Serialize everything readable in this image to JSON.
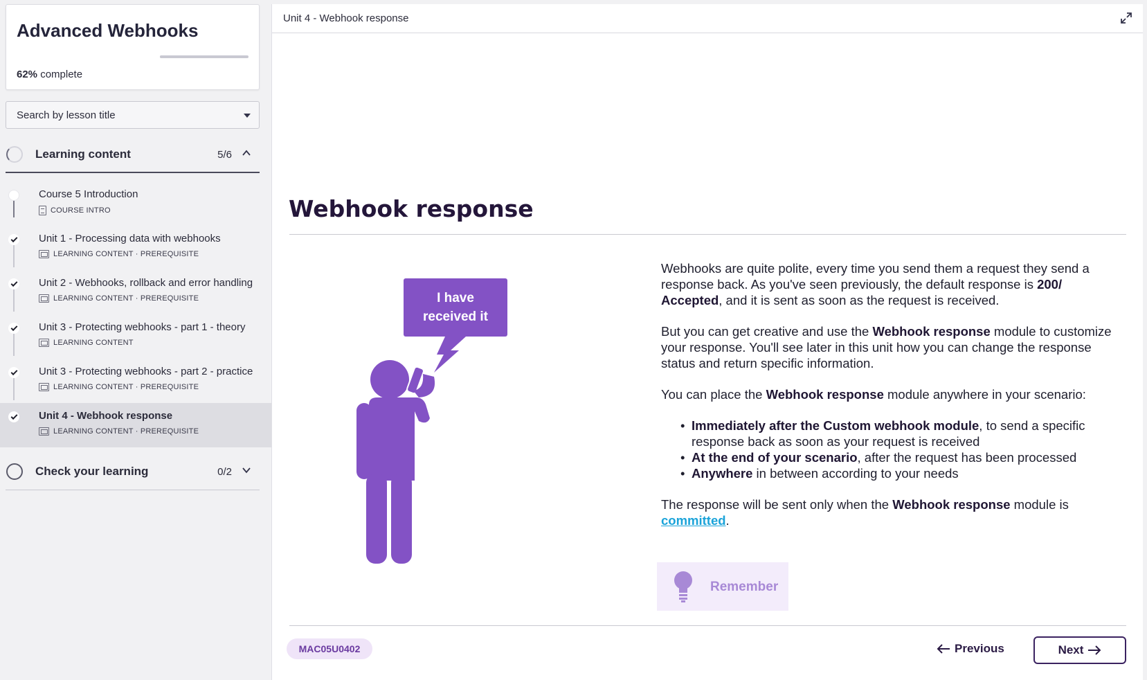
{
  "course": {
    "title": "Advanced Webhooks",
    "progress_percent_label": "62%",
    "progress_suffix": "complete",
    "progress_fraction": 0.62
  },
  "search": {
    "placeholder": "Search by lesson title"
  },
  "sections": [
    {
      "title": "Learning content",
      "count": "5/6",
      "expanded": true
    },
    {
      "title": "Check your learning",
      "count": "0/2",
      "expanded": false
    }
  ],
  "lessons": [
    {
      "title": "Course 5 Introduction",
      "meta": "COURSE INTRO",
      "done": false,
      "active": false
    },
    {
      "title": "Unit 1 - Processing data with webhooks",
      "meta": "LEARNING CONTENT · PREREQUISITE",
      "done": true,
      "active": false
    },
    {
      "title": "Unit 2 - Webhooks, rollback and error handling",
      "meta": "LEARNING CONTENT · PREREQUISITE",
      "done": true,
      "active": false
    },
    {
      "title": "Unit 3 - Protecting webhooks - part 1 - theory",
      "meta": "LEARNING CONTENT",
      "done": true,
      "active": false
    },
    {
      "title": "Unit 3 - Protecting webhooks - part 2 - practice",
      "meta": "LEARNING CONTENT · PREREQUISITE",
      "done": true,
      "active": false
    },
    {
      "title": "Unit 4 - Webhook response",
      "meta": "LEARNING CONTENT · PREREQUISITE",
      "done": true,
      "active": true
    }
  ],
  "main": {
    "topbar_title": "Unit 4 - Webhook response",
    "heading": "Webhook response",
    "speech_bubble": [
      "I have",
      "received it"
    ],
    "p1_a": "Webhooks are quite polite, every time you send them a request they send a response back. As you've seen previously, the default response is ",
    "p1_b": "200/ Accepted",
    "p1_c": ", and it is sent as soon as the request is received.",
    "p2_a": "But you can get creative and use the ",
    "p2_b": "Webhook response",
    "p2_c": " module to customize your response. You'll see later in this unit how you can change the response status and return specific information.",
    "p3_a": "You can place the ",
    "p3_b": "Webhook response",
    "p3_c": " module anywhere in your scenario:",
    "bullets": [
      {
        "bold": "Immediately after the Custom webhook module",
        "rest": ", to send a specific response back as soon as your request is received"
      },
      {
        "bold": "At the end of your scenario",
        "rest": ", after the request has been processed"
      },
      {
        "bold": "Anywhere",
        "rest": " in between according to your needs"
      }
    ],
    "p4_a": "The response will be sent only when the ",
    "p4_b": "Webhook response",
    "p4_c": " module is ",
    "p4_link": "committed",
    "p4_d": ".",
    "remember_label": "Remember",
    "code": "MAC05U0402",
    "prev_label": "Previous",
    "next_label": "Next"
  },
  "colors": {
    "accent_purple": "#8352c5",
    "link_blue": "#1aa3d9",
    "dark_purple": "#2a1a44"
  }
}
